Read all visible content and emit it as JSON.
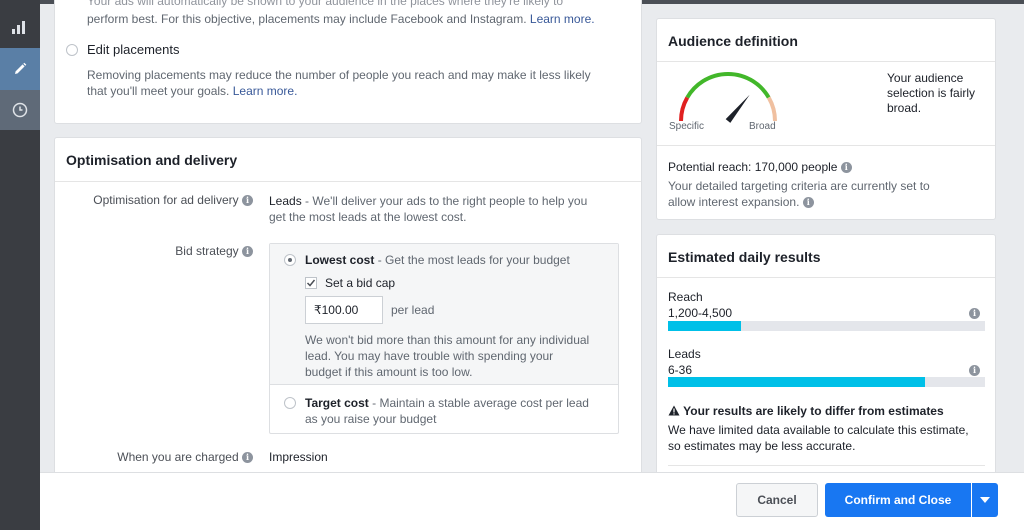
{
  "placements": {
    "auto_desc_tail": "perform best. For this objective, placements may include Facebook and Instagram.",
    "auto_link": "Learn more.",
    "edit_label": "Edit placements",
    "edit_desc_1": "Removing placements may reduce the number of people you reach and may make it less likely",
    "edit_desc_2": "that you'll meet your goals.",
    "edit_link": "Learn more."
  },
  "optimisation": {
    "title": "Optimisation and delivery",
    "ad_delivery_label": "Optimisation for ad delivery",
    "ad_delivery_value": "Leads",
    "ad_delivery_desc_1": " - We'll deliver your ads to the right people to help you",
    "ad_delivery_desc_2": "get the most leads at the lowest cost.",
    "bid_strategy_label": "Bid strategy",
    "lowest_cost_label": "Lowest cost",
    "lowest_cost_desc": " - Get the most leads for your budget",
    "bid_cap_label": "Set a bid cap",
    "bid_cap_value": "₹100.00",
    "per_lead": "per lead",
    "bid_note_1": "We won't bid more than this amount for any individual",
    "bid_note_2": "lead. You may have trouble with spending your",
    "bid_note_3": "budget if this amount is too low.",
    "target_cost_label": "Target cost",
    "target_cost_desc_1": " - Maintain a stable average cost per lead",
    "target_cost_desc_2": "as you raise your budget",
    "charged_label": "When you are charged",
    "charged_value": "Impression"
  },
  "audience": {
    "title": "Audience definition",
    "gauge_left": "Specific",
    "gauge_right": "Broad",
    "gauge_level": 0.72,
    "summary_1": "Your audience",
    "summary_2": "selection is fairly",
    "summary_3": "broad.",
    "potential_reach": "Potential reach: 170,000 people",
    "targeting_1": "Your detailed targeting criteria are currently set to",
    "targeting_2": "allow interest expansion."
  },
  "estimates": {
    "title": "Estimated daily results",
    "reach_label": "Reach",
    "reach_value": "1,200-4,500",
    "reach_fill": 0.23,
    "leads_label": "Leads",
    "leads_value": "6-36",
    "leads_fill": 0.81,
    "warning_title": "Your results are likely to differ from estimates",
    "warning_1": "We have limited data available to calculate this estimate,",
    "warning_2": "so estimates may be less accurate."
  },
  "footer": {
    "cancel": "Cancel",
    "confirm": "Confirm and Close"
  },
  "colors": {
    "accent": "#1877f2",
    "bar_fill": "#00c0e8",
    "bar_bg": "#e4e6eb",
    "sidebar": "#3a3d42",
    "sidebar_active": "#5a7fa6"
  },
  "icons": [
    "chart-icon",
    "pencil-icon",
    "clock-icon",
    "info-icon",
    "warning-icon",
    "checkbox-check-icon",
    "dropdown-arrow-icon"
  ]
}
